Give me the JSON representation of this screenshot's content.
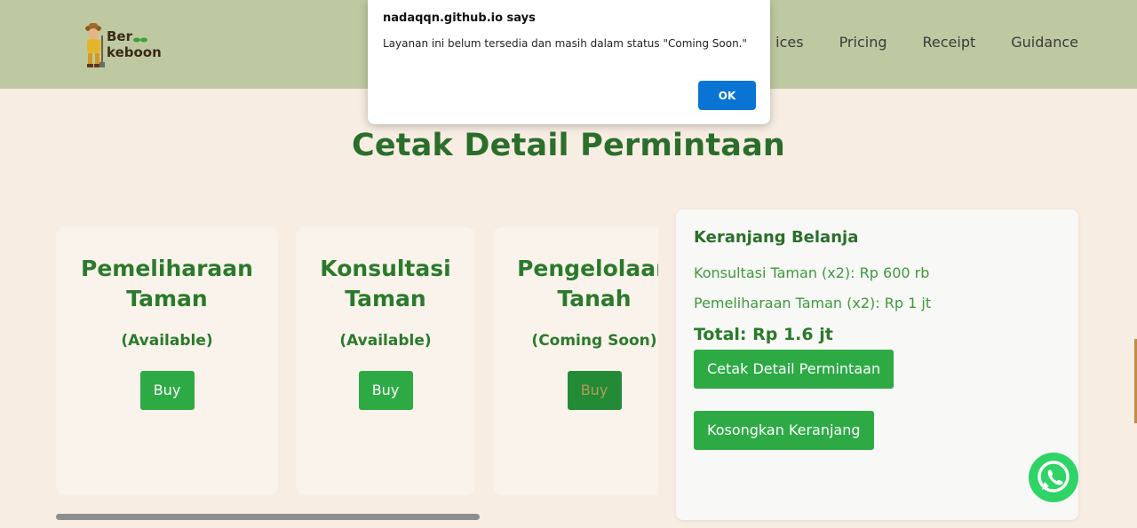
{
  "header": {
    "logo_line1": "Ber",
    "logo_line2": "keboon",
    "nav": [
      "ices",
      "Pricing",
      "Receipt",
      "Guidance"
    ]
  },
  "page_title": "Cetak Detail Permintaan",
  "cards": [
    {
      "title_line1": "Pemeliharaan",
      "title_line2": "Taman",
      "status": "(Available)",
      "button": "Buy"
    },
    {
      "title_line1": "Konsultasi",
      "title_line2": "Taman",
      "status": "(Available)",
      "button": "Buy"
    },
    {
      "title_line1": "Pengelolaan",
      "title_line2": "Tanah",
      "status": "(Coming Soon)",
      "button": "Buy"
    }
  ],
  "cart": {
    "title": "Keranjang Belanja",
    "items": [
      "Konsultasi Taman (x2): Rp 600 rb",
      "Pemeliharaan Taman (x2): Rp 1 jt"
    ],
    "total": "Total: Rp 1.6 jt",
    "print_button": "Cetak Detail Permintaan",
    "clear_button": "Kosongkan Keranjang"
  },
  "dialog": {
    "origin": "nadaqqn.github.io says",
    "message": "Layanan ini belum tersedia dan masih dalam status \"Coming Soon.\"",
    "ok_button": "OK"
  },
  "colors": {
    "header_bg": "#bfc9a1",
    "page_bg": "#f7ede3",
    "accent_green": "#2eaa45",
    "title_green": "#2b6e2b",
    "dialog_ok": "#0a74d4",
    "whatsapp": "#2fd366"
  },
  "icons": {
    "logo": "farmer-mascot-logo",
    "whatsapp": "whatsapp-icon"
  }
}
